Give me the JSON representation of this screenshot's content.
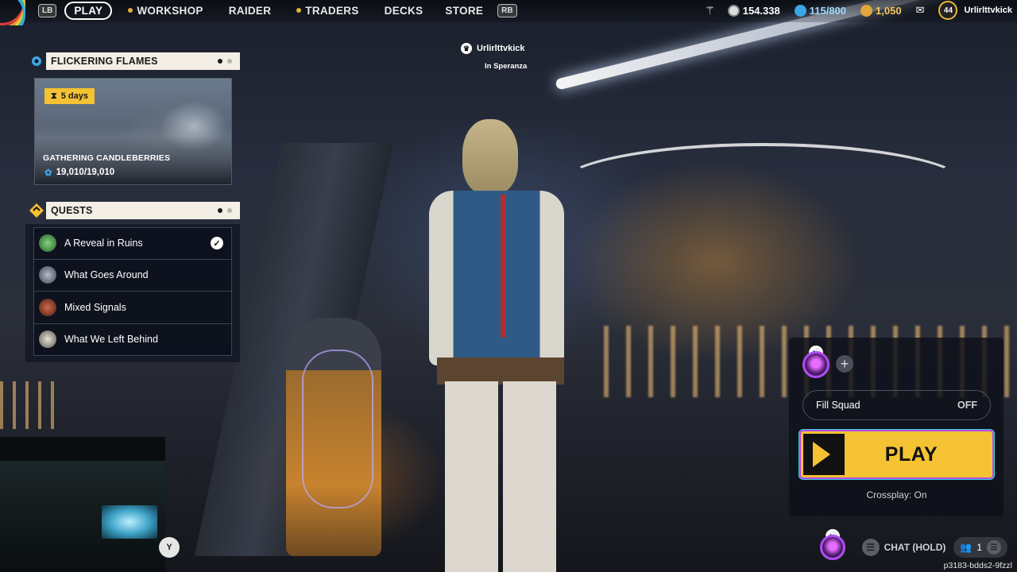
{
  "nav": {
    "lb": "LB",
    "rb": "RB",
    "items": [
      {
        "label": "PLAY",
        "active": true
      },
      {
        "label": "WORKSHOP",
        "icon": "dot-icon"
      },
      {
        "label": "RAIDER"
      },
      {
        "label": "TRADERS",
        "icon": "dot-icon"
      },
      {
        "label": "DECKS"
      },
      {
        "label": "STORE"
      }
    ]
  },
  "currency": {
    "credits": "154.338",
    "blueprint": "115/800",
    "coins": "1,050"
  },
  "profile": {
    "level": "44",
    "name": "Urlirlttvkick"
  },
  "player_tag": {
    "name": "Urlirlttvkick",
    "location": "In Speranza"
  },
  "event": {
    "header": "FLICKERING FLAMES",
    "days": "5  days",
    "title": "GATHERING CANDLEBERRIES",
    "progress": "19,010/19,010"
  },
  "quests": {
    "header": "QUESTS",
    "items": [
      {
        "label": "A Reveal in Ruins",
        "done": true
      },
      {
        "label": "What Goes Around",
        "done": false
      },
      {
        "label": "Mixed Signals",
        "done": false
      },
      {
        "label": "What We Left Behind",
        "done": false
      }
    ]
  },
  "squad": {
    "fill_squad_label": "Fill Squad",
    "fill_squad_value": "OFF",
    "play_label": "PLAY",
    "crossplay": "Crossplay: On"
  },
  "bottom": {
    "chat": "CHAT (HOLD)",
    "party_count": "1",
    "session_id": "p3183-bdds2-9fzzl",
    "y_label": "Y"
  },
  "colors": {
    "accent_yellow": "#f4c232",
    "panel_cream": "#f3efe6",
    "squad_purple": "#b24df0"
  }
}
